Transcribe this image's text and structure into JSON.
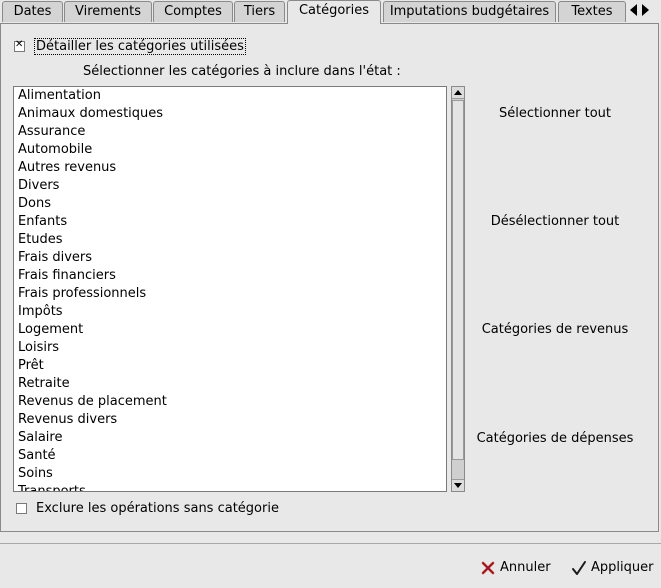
{
  "tabs": [
    {
      "label": "Dates",
      "active": false
    },
    {
      "label": "Virements",
      "active": false
    },
    {
      "label": "Comptes",
      "active": false
    },
    {
      "label": "Tiers",
      "active": false
    },
    {
      "label": "Catégories",
      "active": true
    },
    {
      "label": "Imputations budgétaires",
      "active": false
    },
    {
      "label": "Textes",
      "active": false
    }
  ],
  "detail_checkbox": {
    "label": "Détailler les catégories utilisées",
    "checked": true
  },
  "instruction": "Sélectionner les catégories à inclure dans l'état :",
  "categories": [
    "Alimentation",
    "Animaux domestiques",
    "Assurance",
    "Automobile",
    "Autres revenus",
    "Divers",
    "Dons",
    "Enfants",
    "Etudes",
    "Frais divers",
    "Frais financiers",
    "Frais professionnels",
    "Impôts",
    "Logement",
    "Loisirs",
    "Prêt",
    "Retraite",
    "Revenus de placement",
    "Revenus divers",
    "Salaire",
    "Santé",
    "Soins",
    "Transports"
  ],
  "side_buttons": {
    "select_all": "Sélectionner tout",
    "deselect_all": "Désélectionner tout",
    "income_categories": "Catégories de revenus",
    "expense_categories": "Catégories de dépenses"
  },
  "exclude_checkbox": {
    "label": "Exclure les opérations sans catégorie",
    "checked": false
  },
  "actions": {
    "cancel_label": "Annuler",
    "apply_label": "Appliquer"
  },
  "colors": {
    "cancel_icon": "#c0272d",
    "apply_icon": "#1a1a1a"
  }
}
